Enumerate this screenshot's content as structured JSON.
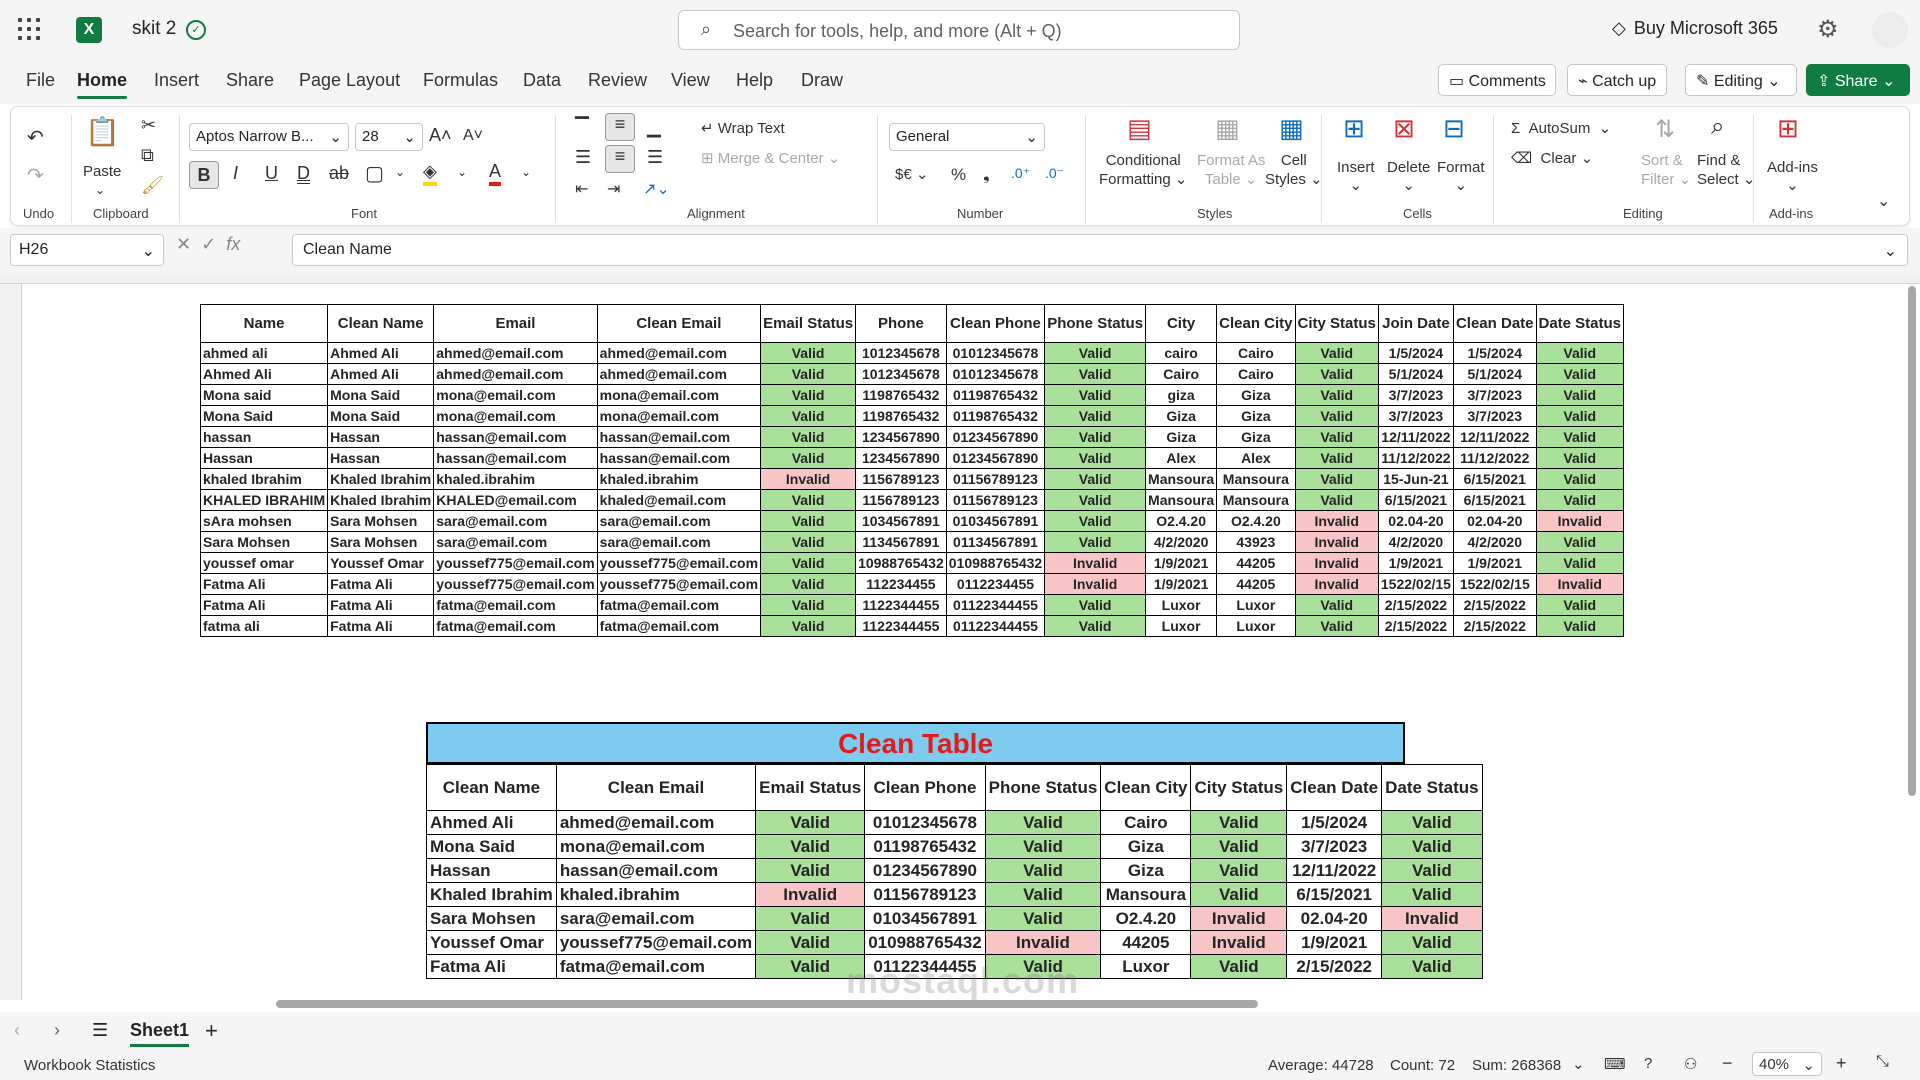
{
  "app": {
    "doc_title": "skit 2",
    "search_placeholder": "Search for tools, help, and more (Alt + Q)",
    "buy_label": "Buy Microsoft 365"
  },
  "menu_tabs": [
    "File",
    "Home",
    "Insert",
    "Share",
    "Page Layout",
    "Formulas",
    "Data",
    "Review",
    "View",
    "Help",
    "Draw"
  ],
  "top_buttons": {
    "comments": "Comments",
    "catchup": "Catch up",
    "editing": "Editing",
    "share": "Share"
  },
  "ribbon": {
    "undo_group": "Undo",
    "clipboard": {
      "paste": "Paste",
      "group": "Clipboard"
    },
    "font": {
      "name": "Aptos Narrow B...",
      "size": "28",
      "group": "Font"
    },
    "alignment": {
      "wrap": "Wrap Text",
      "merge": "Merge & Center",
      "group": "Alignment"
    },
    "number": {
      "format": "General",
      "currency": "$€",
      "percent": "%",
      "group": "Number"
    },
    "styles": {
      "conditional": [
        "Conditional",
        "Formatting"
      ],
      "format_as": [
        "Format As",
        "Table"
      ],
      "cell": [
        "Cell",
        "Styles"
      ],
      "group": "Styles"
    },
    "cells": {
      "insert": "Insert",
      "delete": "Delete",
      "format": "Format",
      "group": "Cells"
    },
    "editing": {
      "autosum": "AutoSum",
      "clear": "Clear",
      "sort": [
        "Sort &",
        "Filter"
      ],
      "find": [
        "Find &",
        "Select"
      ],
      "group": "Editing"
    },
    "addins": {
      "label": "Add-ins",
      "group": "Add-ins"
    }
  },
  "formula_bar": {
    "cell_ref": "H26",
    "formula": "Clean Name"
  },
  "raw_table": {
    "headers": [
      "Name",
      "Clean Name",
      "Email",
      "Clean Email",
      "Email Status",
      "Phone",
      "Clean Phone",
      "Phone Status",
      "City",
      "Clean City",
      "City Status",
      "Join Date",
      "Clean Date",
      "Date Status"
    ],
    "rows": [
      [
        "ahmed ali",
        "Ahmed Ali",
        "ahmed@email.com",
        "ahmed@email.com",
        "Valid",
        "1012345678",
        "01012345678",
        "Valid",
        "cairo",
        "Cairo",
        "Valid",
        "1/5/2024",
        "1/5/2024",
        "Valid"
      ],
      [
        "Ahmed Ali",
        "Ahmed Ali",
        "ahmed@email.com",
        "ahmed@email.com",
        "Valid",
        "1012345678",
        "01012345678",
        "Valid",
        "Cairo",
        "Cairo",
        "Valid",
        "5/1/2024",
        "5/1/2024",
        "Valid"
      ],
      [
        "Mona said",
        "Mona Said",
        "mona@email.com",
        "mona@email.com",
        "Valid",
        "1198765432",
        "01198765432",
        "Valid",
        "giza",
        "Giza",
        "Valid",
        "3/7/2023",
        "3/7/2023",
        "Valid"
      ],
      [
        "Mona Said",
        "Mona Said",
        "mona@email.com",
        "mona@email.com",
        "Valid",
        "1198765432",
        "01198765432",
        "Valid",
        "Giza",
        "Giza",
        "Valid",
        "3/7/2023",
        "3/7/2023",
        "Valid"
      ],
      [
        "hassan",
        "Hassan",
        "hassan@email.com",
        "hassan@email.com",
        "Valid",
        "1234567890",
        "01234567890",
        "Valid",
        "Giza",
        "Giza",
        "Valid",
        "12/11/2022",
        "12/11/2022",
        "Valid"
      ],
      [
        "Hassan",
        "Hassan",
        "hassan@email.com",
        "hassan@email.com",
        "Valid",
        "1234567890",
        "01234567890",
        "Valid",
        "Alex",
        "Alex",
        "Valid",
        "11/12/2022",
        "11/12/2022",
        "Valid"
      ],
      [
        "khaled Ibrahim",
        "Khaled Ibrahim",
        "khaled.ibrahim",
        "khaled.ibrahim",
        "Invalid",
        "1156789123",
        "01156789123",
        "Valid",
        "Mansoura",
        "Mansoura",
        "Valid",
        "15-Jun-21",
        "6/15/2021",
        "Valid"
      ],
      [
        "KHALED IBRAHIM",
        "Khaled Ibrahim",
        "KHALED@email.com",
        "khaled@email.com",
        "Valid",
        "1156789123",
        "01156789123",
        "Valid",
        "Mansoura",
        "Mansoura",
        "Valid",
        "6/15/2021",
        "6/15/2021",
        "Valid"
      ],
      [
        "sAra mohsen",
        "Sara Mohsen",
        "sara@email.com",
        "sara@email.com",
        "Valid",
        "1034567891",
        "01034567891",
        "Valid",
        "O2.4.20",
        "O2.4.20",
        "Invalid",
        "02.04-20",
        "02.04-20",
        "Invalid"
      ],
      [
        "Sara Mohsen",
        "Sara Mohsen",
        "sara@email.com",
        "sara@email.com",
        "Valid",
        "1134567891",
        "01134567891",
        "Valid",
        "4/2/2020",
        "43923",
        "Invalid",
        "4/2/2020",
        "4/2/2020",
        "Valid"
      ],
      [
        "youssef omar",
        "Youssef Omar",
        "youssef775@email.com",
        "youssef775@email.com",
        "Valid",
        "10988765432",
        "010988765432",
        "Invalid",
        "1/9/2021",
        "44205",
        "Invalid",
        "1/9/2021",
        "1/9/2021",
        "Valid"
      ],
      [
        "Fatma Ali",
        "Fatma Ali",
        "youssef775@email.com",
        "youssef775@email.com",
        "Valid",
        "112234455",
        "0112234455",
        "Invalid",
        "1/9/2021",
        "44205",
        "Invalid",
        "1522/02/15",
        "1522/02/15",
        "Invalid"
      ],
      [
        "Fatma Ali",
        "Fatma Ali",
        "fatma@email.com",
        "fatma@email.com",
        "Valid",
        "1122344455",
        "01122344455",
        "Valid",
        "Luxor",
        "Luxor",
        "Valid",
        "2/15/2022",
        "2/15/2022",
        "Valid"
      ],
      [
        "fatma ali",
        "Fatma Ali",
        "fatma@email.com",
        "fatma@email.com",
        "Valid",
        "1122344455",
        "01122344455",
        "Valid",
        "Luxor",
        "Luxor",
        "Valid",
        "2/15/2022",
        "2/15/2022",
        "Valid"
      ]
    ]
  },
  "clean_table": {
    "title": "Clean Table",
    "headers": [
      "Clean Name",
      "Clean Email",
      "Email Status",
      "Clean Phone",
      "Phone Status",
      "Clean City",
      "City Status",
      "Clean Date",
      "Date Status"
    ],
    "rows": [
      [
        "Ahmed Ali",
        "ahmed@email.com",
        "Valid",
        "01012345678",
        "Valid",
        "Cairo",
        "Valid",
        "1/5/2024",
        "Valid"
      ],
      [
        "Mona Said",
        "mona@email.com",
        "Valid",
        "01198765432",
        "Valid",
        "Giza",
        "Valid",
        "3/7/2023",
        "Valid"
      ],
      [
        "Hassan",
        "hassan@email.com",
        "Valid",
        "01234567890",
        "Valid",
        "Giza",
        "Valid",
        "12/11/2022",
        "Valid"
      ],
      [
        "Khaled Ibrahim",
        "khaled.ibrahim",
        "Invalid",
        "01156789123",
        "Valid",
        "Mansoura",
        "Valid",
        "6/15/2021",
        "Valid"
      ],
      [
        "Sara Mohsen",
        "sara@email.com",
        "Valid",
        "01034567891",
        "Valid",
        "O2.4.20",
        "Invalid",
        "02.04-20",
        "Invalid"
      ],
      [
        "Youssef Omar",
        "youssef775@email.com",
        "Valid",
        "010988765432",
        "Invalid",
        "44205",
        "Invalid",
        "1/9/2021",
        "Valid"
      ],
      [
        "Fatma Ali",
        "fatma@email.com",
        "Valid",
        "01122344455",
        "Valid",
        "Luxor",
        "Valid",
        "2/15/2022",
        "Valid"
      ]
    ]
  },
  "sheet_tab": "Sheet1",
  "status_bar": {
    "left": "Workbook Statistics",
    "average": "Average: 44728",
    "count": "Count: 72",
    "sum": "Sum: 268368",
    "zoom": "40%"
  },
  "watermark": "mostaql.com",
  "colors": {
    "valid": "#a9e19a",
    "invalid": "#f7c5c5",
    "accent": "#107c41",
    "clean_header": "#7ecbf0",
    "clean_title": "#e21b1b"
  }
}
